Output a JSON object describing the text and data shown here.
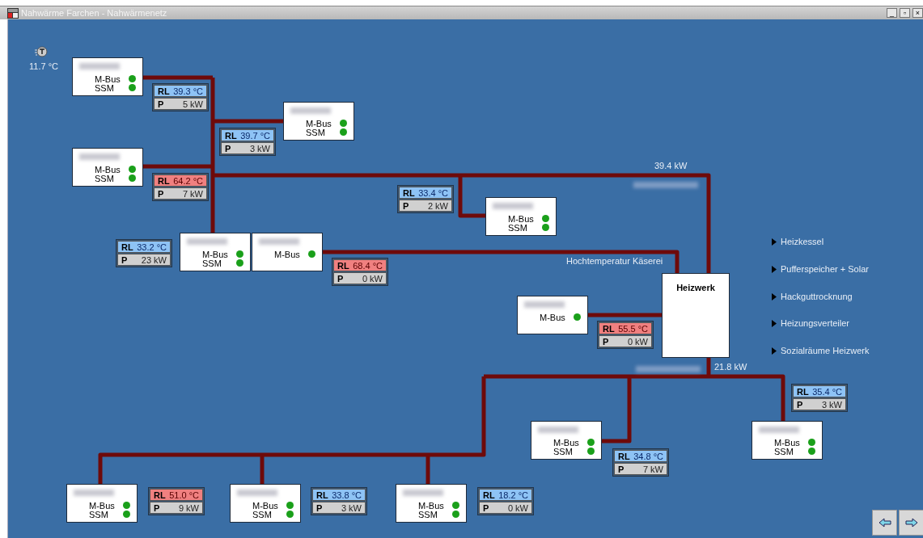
{
  "window": {
    "title": "Nahwärme Farchen - Nahwärmenetz",
    "controls": [
      "_",
      "▫",
      "×"
    ]
  },
  "outdoor": {
    "temperature": "11.7 °C"
  },
  "nodes": [
    {
      "kind": "station",
      "signals": [
        {
          "label": "M-Bus",
          "ok": true
        },
        {
          "label": "SSM",
          "ok": true
        }
      ],
      "reading": {
        "rl": "RL",
        "temp": "39.3 °C",
        "alarm": false,
        "p": "P",
        "power": "5 kW"
      }
    },
    {
      "kind": "station",
      "signals": [
        {
          "label": "M-Bus",
          "ok": true
        },
        {
          "label": "SSM",
          "ok": true
        }
      ],
      "reading": {
        "rl": "RL",
        "temp": "39.7 °C",
        "alarm": false,
        "p": "P",
        "power": "3 kW"
      }
    },
    {
      "kind": "station",
      "signals": [
        {
          "label": "M-Bus",
          "ok": true
        },
        {
          "label": "SSM",
          "ok": true
        }
      ],
      "reading": {
        "rl": "RL",
        "temp": "64.2 °C",
        "alarm": true,
        "p": "P",
        "power": "7 kW"
      }
    },
    {
      "kind": "station",
      "signals": [
        {
          "label": "M-Bus",
          "ok": true
        },
        {
          "label": "SSM",
          "ok": true
        }
      ],
      "reading": {
        "rl": "RL",
        "temp": "33.4 °C",
        "alarm": false,
        "p": "P",
        "power": "2 kW"
      }
    },
    {
      "kind": "station",
      "signals": [
        {
          "label": "M-Bus",
          "ok": true
        },
        {
          "label": "SSM",
          "ok": true
        }
      ],
      "reading": {
        "rl": "RL",
        "temp": "33.2 °C",
        "alarm": false,
        "p": "P",
        "power": "23 kW"
      }
    },
    {
      "kind": "station",
      "signals": [
        {
          "label": "M-Bus",
          "ok": true
        }
      ],
      "reading": {
        "rl": "RL",
        "temp": "68.4 °C",
        "alarm": true,
        "p": "P",
        "power": "0 kW"
      }
    },
    {
      "kind": "station",
      "signals": [
        {
          "label": "M-Bus",
          "ok": true
        }
      ],
      "reading": {
        "rl": "RL",
        "temp": "55.5 °C",
        "alarm": true,
        "p": "P",
        "power": "0 kW"
      }
    },
    {
      "kind": "plant",
      "title": "Heizwerk"
    },
    {
      "kind": "station",
      "signals": [
        {
          "label": "M-Bus",
          "ok": true
        },
        {
          "label": "SSM",
          "ok": true
        }
      ],
      "reading": {
        "rl": "RL",
        "temp": "35.4 °C",
        "alarm": false,
        "p": "P",
        "power": "3 kW"
      }
    },
    {
      "kind": "station",
      "signals": [
        {
          "label": "M-Bus",
          "ok": true
        },
        {
          "label": "SSM",
          "ok": true
        }
      ],
      "reading": {
        "rl": "RL",
        "temp": "34.8 °C",
        "alarm": false,
        "p": "P",
        "power": "7 kW"
      }
    },
    {
      "kind": "station",
      "signals": [
        {
          "label": "M-Bus",
          "ok": true
        },
        {
          "label": "SSM",
          "ok": true
        }
      ],
      "reading": {
        "rl": "RL",
        "temp": "51.0 °C",
        "alarm": true,
        "p": "P",
        "power": "9 kW"
      }
    },
    {
      "kind": "station",
      "signals": [
        {
          "label": "M-Bus",
          "ok": true
        },
        {
          "label": "SSM",
          "ok": true
        }
      ],
      "reading": {
        "rl": "RL",
        "temp": "33.8 °C",
        "alarm": false,
        "p": "P",
        "power": "3 kW"
      }
    },
    {
      "kind": "station",
      "signals": [
        {
          "label": "M-Bus",
          "ok": true
        },
        {
          "label": "SSM",
          "ok": true
        }
      ],
      "reading": {
        "rl": "RL",
        "temp": "18.2 °C",
        "alarm": false,
        "p": "P",
        "power": "0 kW"
      }
    }
  ],
  "flow_labels": [
    "39.4 kW",
    "Hochtemperatur Käserei",
    "21.8 kW"
  ],
  "links": [
    "Heizkessel",
    "Pufferspeicher + Solar",
    "Hackguttrocknung",
    "Heizungsverteiler",
    "Sozialräume Heizwerk"
  ]
}
